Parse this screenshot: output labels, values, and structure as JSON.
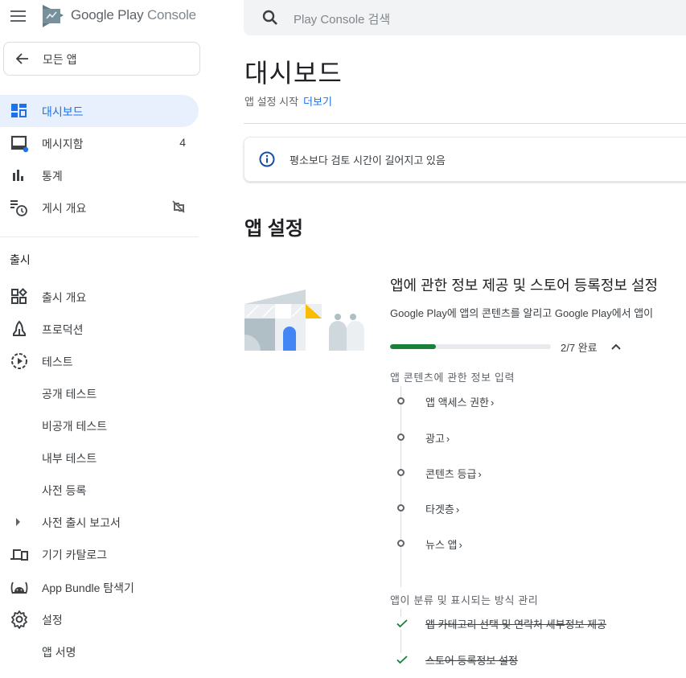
{
  "header": {
    "brand_primary": "Google Play",
    "brand_secondary": "Console",
    "search_placeholder": "Play Console 검색"
  },
  "sidebar": {
    "all_apps_label": "모든 앱",
    "items": [
      {
        "label": "대시보드",
        "icon": "dashboard-icon",
        "active": true
      },
      {
        "label": "메시지함",
        "icon": "inbox-icon",
        "badge": "4"
      },
      {
        "label": "통계",
        "icon": "bar-chart-icon"
      },
      {
        "label": "게시 개요",
        "icon": "publishing-overview-icon",
        "trailing_icon": "sync-disabled-icon"
      }
    ],
    "release_section_title": "출시",
    "release_items": [
      {
        "label": "출시 개요",
        "icon": "release-overview-icon"
      },
      {
        "label": "프로덕션",
        "icon": "production-icon"
      },
      {
        "label": "테스트",
        "icon": "testing-icon"
      },
      {
        "label": "공개 테스트",
        "sub": true
      },
      {
        "label": "비공개 테스트",
        "sub": true
      },
      {
        "label": "내부 테스트",
        "sub": true
      },
      {
        "label": "사전 등록",
        "sub": true
      },
      {
        "label": "사전 출시 보고서",
        "sub": true,
        "expandable": true
      },
      {
        "label": "기기 카탈로그",
        "icon": "devices-icon"
      },
      {
        "label": "App Bundle 탐색기",
        "icon": "android-icon"
      },
      {
        "label": "설정",
        "icon": "settings-icon"
      },
      {
        "label": "앱 서명",
        "sub": true
      }
    ]
  },
  "main": {
    "title": "대시보드",
    "subtitle": "앱 설정 시작",
    "more_link": "더보기",
    "notice": "평소보다 검토 시간이 길어지고 있음",
    "section_heading": "앱 설정",
    "task": {
      "title": "앱에 관한 정보 제공 및 스토어 등록정보 설정",
      "description": "Google Play에 앱의 콘텐츠를 알리고 Google Play에서 앱이",
      "progress_done": 2,
      "progress_total": 7,
      "progress_label": "2/7 완료",
      "groups": [
        {
          "label": "앱 콘텐츠에 관한 정보 입력",
          "steps": [
            {
              "label": "앱 액세스 권한",
              "done": false
            },
            {
              "label": "광고",
              "done": false
            },
            {
              "label": "콘텐츠 등급",
              "done": false
            },
            {
              "label": "타겟층",
              "done": false
            },
            {
              "label": "뉴스 앱",
              "done": false
            }
          ]
        },
        {
          "label": "앱이 분류 및 표시되는 방식 관리",
          "steps": [
            {
              "label": "앱 카테고리 선택 및 연락처 세부정보 제공",
              "done": true
            },
            {
              "label": "스토어 등록정보 설정",
              "done": true
            }
          ]
        }
      ]
    }
  },
  "colors": {
    "accent": "#1a73e8",
    "active_bg": "#e8f0fe",
    "progress": "#188038",
    "check": "#188038"
  }
}
